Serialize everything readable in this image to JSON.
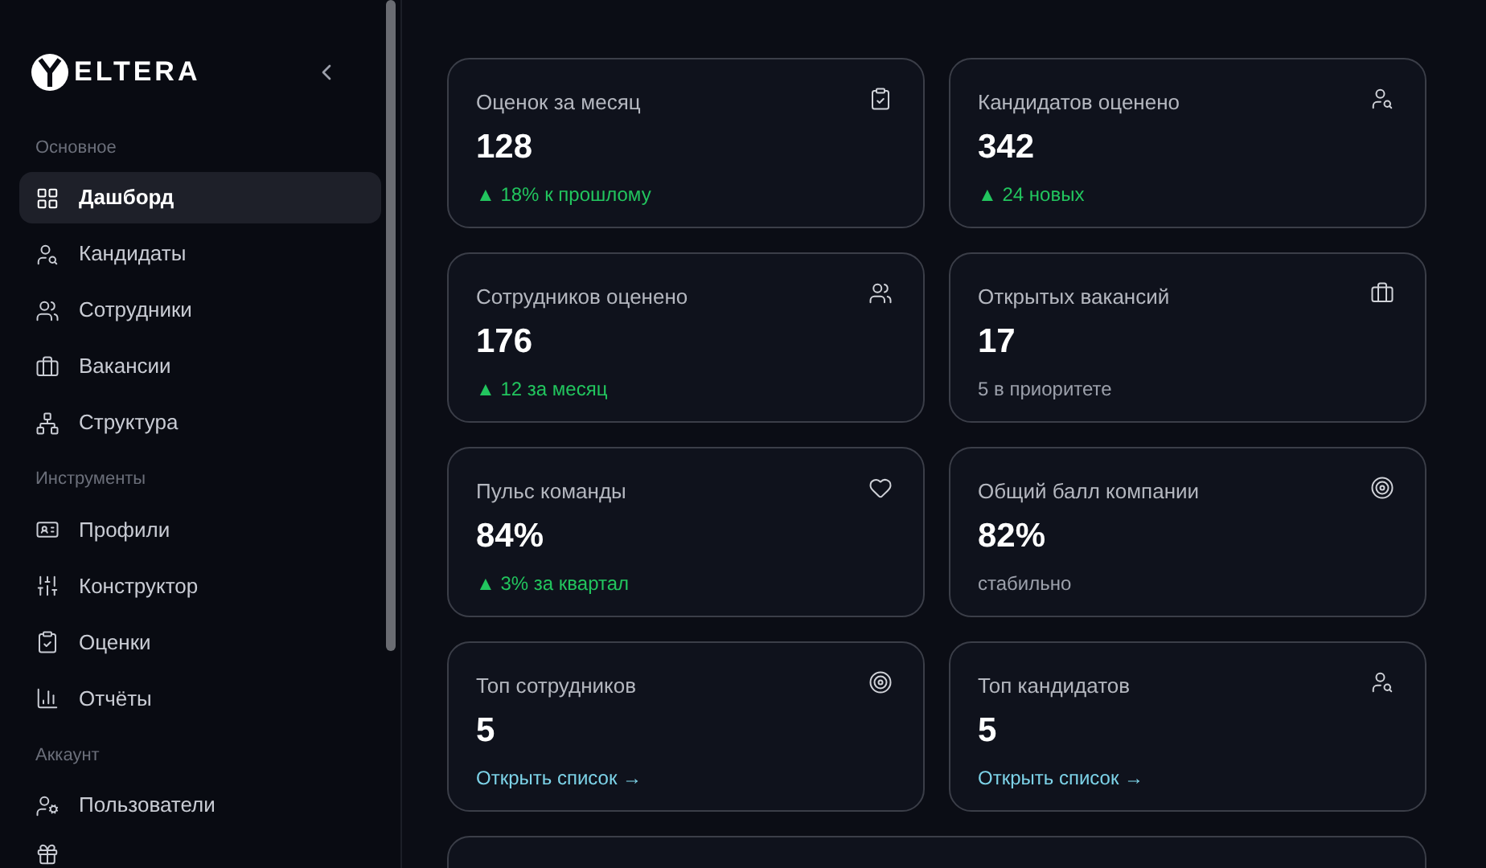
{
  "brand": {
    "name": "ELTERA"
  },
  "sidebar": {
    "sections": [
      {
        "title": "Основное",
        "items": [
          {
            "label": "Дашборд",
            "selected": true
          },
          {
            "label": "Кандидаты",
            "selected": false
          },
          {
            "label": "Сотрудники",
            "selected": false
          },
          {
            "label": "Вакансии",
            "selected": false
          },
          {
            "label": "Структура",
            "selected": false
          }
        ]
      },
      {
        "title": "Инструменты",
        "items": [
          {
            "label": "Профили",
            "selected": false
          },
          {
            "label": "Конструктор",
            "selected": false
          },
          {
            "label": "Оценки",
            "selected": false
          },
          {
            "label": "Отчёты",
            "selected": false
          }
        ]
      },
      {
        "title": "Аккаунт",
        "items": [
          {
            "label": "Пользователи",
            "selected": false
          }
        ]
      }
    ]
  },
  "cards": [
    {
      "title": "Оценок за месяц",
      "value": "128",
      "note": {
        "kind": "up",
        "text": "▲ 18% к прошлому"
      }
    },
    {
      "title": "Кандидатов оценено",
      "value": "342",
      "note": {
        "kind": "up",
        "text": "▲ 24 новых"
      }
    },
    {
      "title": "Сотрудников оценено",
      "value": "176",
      "note": {
        "kind": "up",
        "text": "▲ 12 за месяц"
      }
    },
    {
      "title": "Открытых вакансий",
      "value": "17",
      "note": {
        "kind": "neutral",
        "text": "5 в приоритете"
      }
    },
    {
      "title": "Пульс команды",
      "value": "84%",
      "note": {
        "kind": "up",
        "text": "▲ 3% за квартал"
      }
    },
    {
      "title": "Общий балл компании",
      "value": "82%",
      "note": {
        "kind": "neutral",
        "text": "стабильно"
      }
    },
    {
      "title": "Топ сотрудников",
      "value": "5",
      "note": {
        "kind": "link",
        "text": "Открыть список →"
      }
    },
    {
      "title": "Топ кандидатов",
      "value": "5",
      "note": {
        "kind": "link",
        "text": "Открыть список →"
      }
    }
  ]
}
